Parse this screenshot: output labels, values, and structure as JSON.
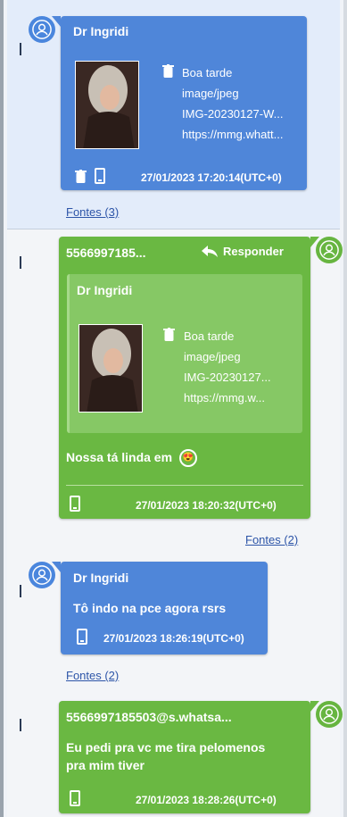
{
  "messages": [
    {
      "sender": "Dr Ingridi",
      "attachment": {
        "caption": "Boa tarde",
        "mime": "image/jpeg",
        "filename": "IMG-20230127-W...",
        "url": "https://mmg.whatt..."
      },
      "timestamp": "27/01/2023 17:20:14(UTC+0)",
      "sources": "Fontes (3)"
    },
    {
      "sender": "5566997185...",
      "reply_label": "Responder",
      "quoted": {
        "sender": "Dr Ingridi",
        "caption": "Boa tarde",
        "mime": "image/jpeg",
        "filename": "IMG-20230127...",
        "url": "https://mmg.w..."
      },
      "text": "Nossa tá linda em",
      "emoji": "😍",
      "timestamp": "27/01/2023 18:20:32(UTC+0)",
      "sources": "Fontes (2)"
    },
    {
      "sender": "Dr Ingridi",
      "text": "Tô indo na pce agora rsrs",
      "timestamp": "27/01/2023 18:26:19(UTC+0)",
      "sources": "Fontes (2)"
    },
    {
      "sender": "5566997185503@s.whatsa...",
      "text_line1": "Eu pedi pra vc me tira pelomenos",
      "text_line2": "pra mim tiver",
      "timestamp": "27/01/2023 18:28:26(UTC+0)"
    }
  ],
  "colors": {
    "incoming": "#4f86d9",
    "outgoing": "#6ab842",
    "link": "#2d55a8",
    "highlight": "#e3ecfa"
  },
  "icons": [
    "user-icon",
    "trash-icon",
    "phone-icon",
    "reply-icon"
  ]
}
